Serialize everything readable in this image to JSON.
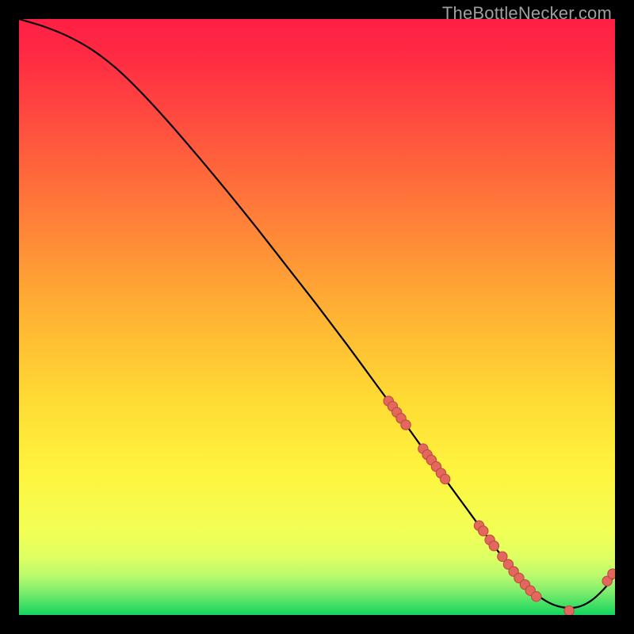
{
  "watermark": "TheBottleNecker.com",
  "colors": {
    "gradient_top": "#ff1f44",
    "gradient_upper_mid": "#ff6a3a",
    "gradient_mid": "#ffd93a",
    "gradient_lower_mid": "#f6ff57",
    "gradient_low": "#c9ff6a",
    "gradient_bottom": "#0fd65d",
    "curve": "#000000",
    "points_fill": "#e4675e",
    "points_stroke": "#b9473f",
    "frame": "#000000"
  },
  "chart_data": {
    "type": "line",
    "title": "",
    "xlabel": "",
    "ylabel": "",
    "xlim": [
      0,
      100
    ],
    "ylim": [
      0,
      100
    ],
    "curve": {
      "x": [
        0,
        4,
        8,
        12,
        16,
        20,
        25,
        30,
        35,
        40,
        45,
        50,
        55,
        60,
        65,
        68,
        72,
        75,
        78,
        80,
        82,
        84,
        86,
        88,
        90,
        92,
        94,
        96,
        98,
        100
      ],
      "y": [
        100,
        98.8,
        97.2,
        95.0,
        92.0,
        88.2,
        82.8,
        77.0,
        71.0,
        64.8,
        58.4,
        52.0,
        45.4,
        38.6,
        31.8,
        27.6,
        22.1,
        18.0,
        13.9,
        11.2,
        8.6,
        6.2,
        4.2,
        2.6,
        1.6,
        1.2,
        1.4,
        2.4,
        4.2,
        6.6
      ]
    },
    "series": [
      {
        "name": "points",
        "x": [
          62,
          62.7,
          63.4,
          64.1,
          64.9,
          67.8,
          68.5,
          69.2,
          70.0,
          70.8,
          71.5,
          77.2,
          77.9,
          79.0,
          79.7,
          81.1,
          82.1,
          83.0,
          83.9,
          84.9,
          85.8,
          86.8,
          92.3,
          98.7,
          99.6
        ],
        "y": [
          35.9,
          35.0,
          34.0,
          33.0,
          31.9,
          27.9,
          26.9,
          26.0,
          24.9,
          23.8,
          22.8,
          15.0,
          14.1,
          12.6,
          11.6,
          9.8,
          8.5,
          7.3,
          6.2,
          5.1,
          4.1,
          3.1,
          0.7,
          5.7,
          6.9
        ]
      }
    ]
  }
}
